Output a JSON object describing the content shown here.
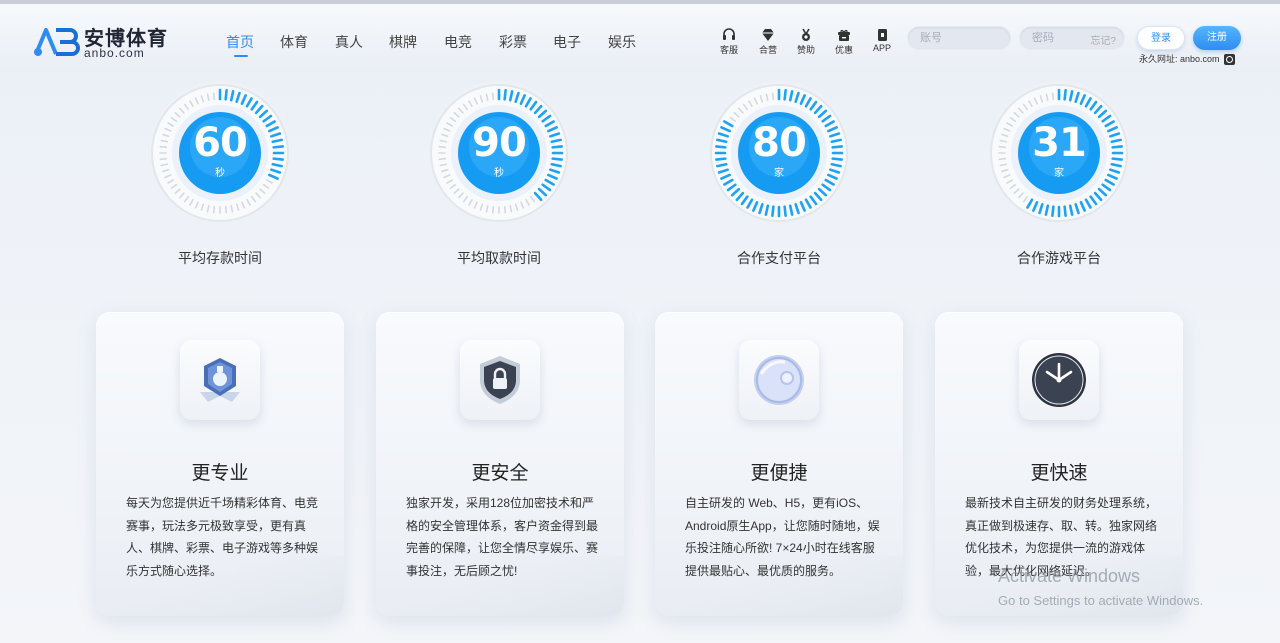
{
  "brand": {
    "title": "安博体育",
    "subtitle": "anbo.com"
  },
  "nav": [
    {
      "label": "首页",
      "active": true
    },
    {
      "label": "体育"
    },
    {
      "label": "真人"
    },
    {
      "label": "棋牌"
    },
    {
      "label": "电竞"
    },
    {
      "label": "彩票"
    },
    {
      "label": "电子"
    },
    {
      "label": "娱乐"
    }
  ],
  "quick": [
    {
      "label": "客服",
      "icon": "headset-icon"
    },
    {
      "label": "合营",
      "icon": "diamond-icon"
    },
    {
      "label": "赞助",
      "icon": "medal-icon"
    },
    {
      "label": "优惠",
      "icon": "gift-icon"
    },
    {
      "label": "APP",
      "icon": "phone-icon"
    }
  ],
  "login": {
    "account_placeholder": "账号",
    "password_placeholder": "密码",
    "forgot": "忘记?",
    "login_label": "登录",
    "register_label": "注册",
    "permalink": "永久网址: anbo.com"
  },
  "stats": [
    {
      "value": "60",
      "unit": "秒",
      "label": "平均存款时间",
      "fill": 0.32
    },
    {
      "value": "90",
      "unit": "秒",
      "label": "平均取款时间",
      "fill": 0.4
    },
    {
      "value": "80",
      "unit": "家",
      "label": "合作支付平台",
      "fill": 0.85
    },
    {
      "value": "31",
      "unit": "家",
      "label": "合作游戏平台",
      "fill": 0.6
    }
  ],
  "features": [
    {
      "title": "更专业",
      "icon": "medal-badge-icon",
      "desc": "每天为您提供近千场精彩体育、电竞赛事，玩法多元极致享受，更有真人、棋牌、彩票、电子游戏等多种娱乐方式随心选择。"
    },
    {
      "title": "更安全",
      "icon": "shield-lock-icon",
      "desc": "独家开发，采用128位加密技术和严格的安全管理体系，客户资金得到最完善的保障，让您全情尽享娱乐、赛事投注，无后顾之忧!"
    },
    {
      "title": "更便捷",
      "icon": "sphere-icon",
      "desc": "自主研发的 Web、H5，更有iOS、Android原生App，让您随时随地，娱乐投注随心所欲! 7×24小时在线客服提供最贴心、最优质的服务。"
    },
    {
      "title": "更快速",
      "icon": "clock-icon",
      "desc": "最新技术自主研发的财务处理系统，真正做到极速存、取、转。独家网络优化技术，为您提供一流的游戏体验，最大优化网络延迟。"
    }
  ],
  "watermark": {
    "line1": "Activate Windows",
    "line2": "Go to Settings to activate Windows."
  },
  "colors": {
    "accent": "#2f8cf0",
    "gauge_blue": "#1fa2f5"
  }
}
